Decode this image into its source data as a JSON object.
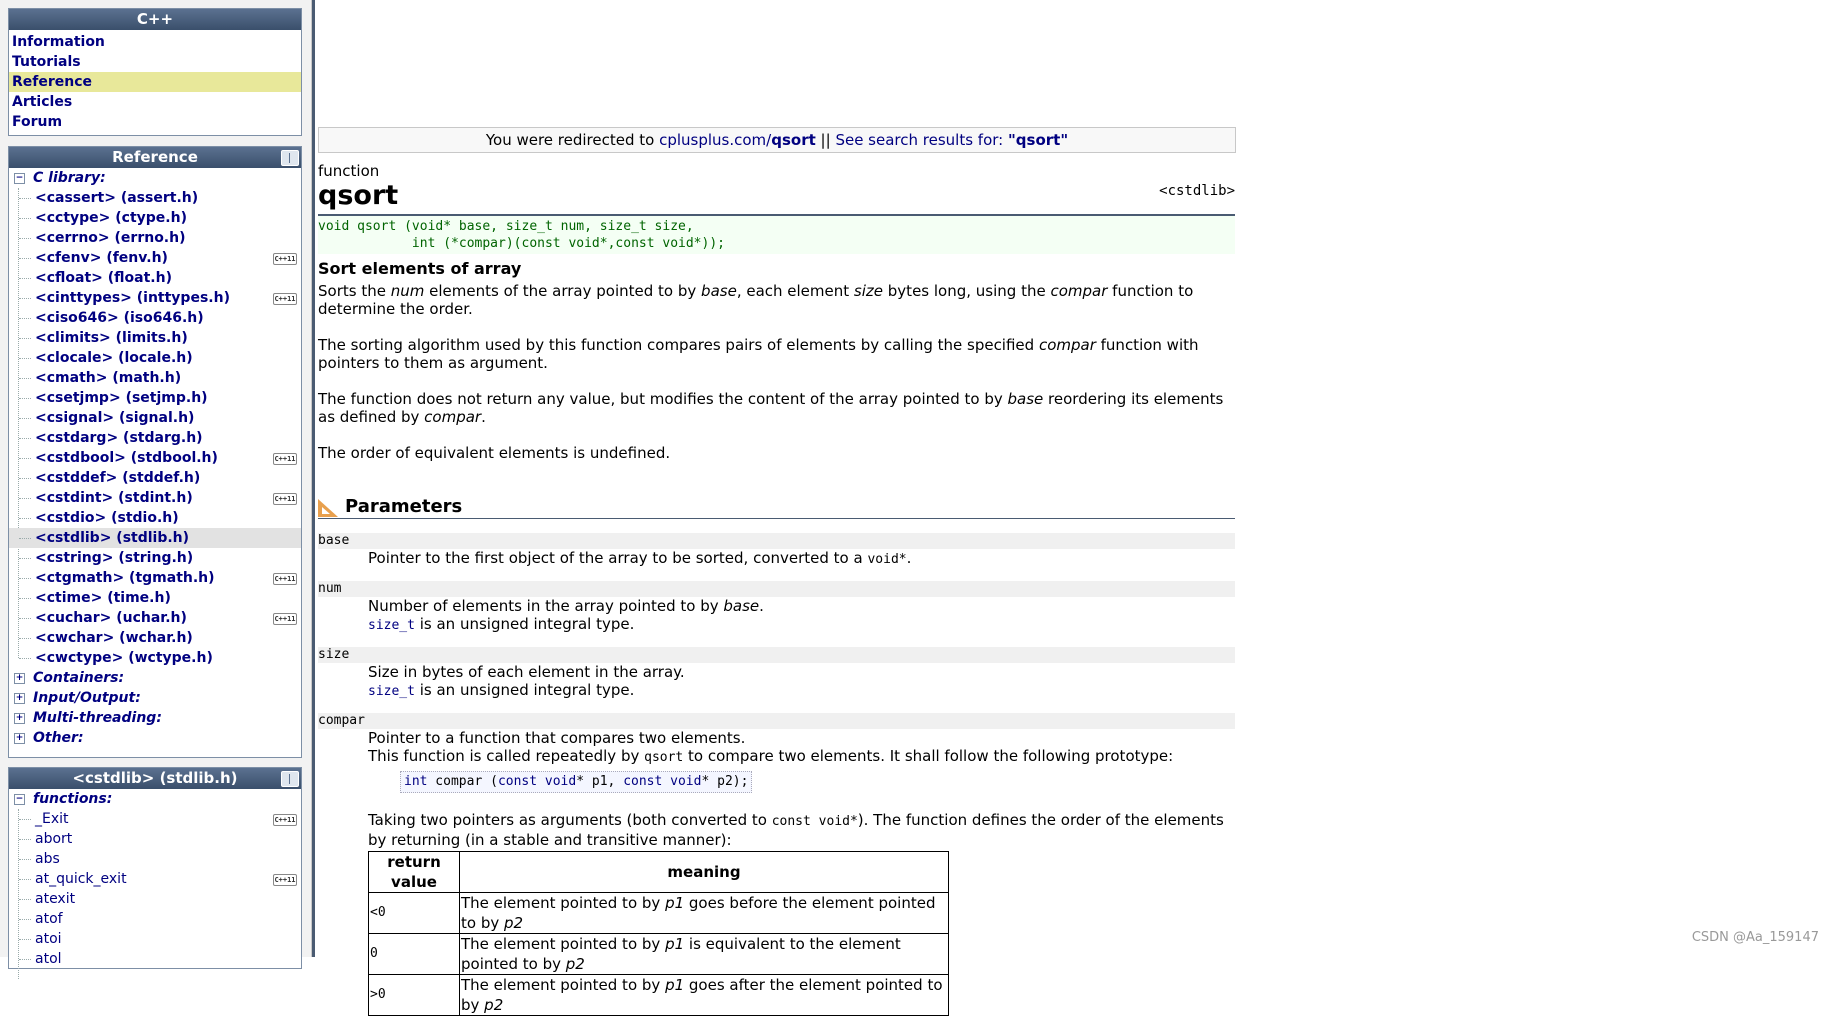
{
  "nav": {
    "title": "C++",
    "items": [
      "Information",
      "Tutorials",
      "Reference",
      "Articles",
      "Forum"
    ],
    "active": "Reference"
  },
  "reference": {
    "title": "Reference",
    "c_library_label": "C library:",
    "headers": [
      {
        "label": "<cassert> (assert.h)",
        "cpp11": false
      },
      {
        "label": "<cctype> (ctype.h)",
        "cpp11": false
      },
      {
        "label": "<cerrno> (errno.h)",
        "cpp11": false
      },
      {
        "label": "<cfenv> (fenv.h)",
        "cpp11": true
      },
      {
        "label": "<cfloat> (float.h)",
        "cpp11": false
      },
      {
        "label": "<cinttypes> (inttypes.h)",
        "cpp11": true
      },
      {
        "label": "<ciso646> (iso646.h)",
        "cpp11": false
      },
      {
        "label": "<climits> (limits.h)",
        "cpp11": false
      },
      {
        "label": "<clocale> (locale.h)",
        "cpp11": false
      },
      {
        "label": "<cmath> (math.h)",
        "cpp11": false
      },
      {
        "label": "<csetjmp> (setjmp.h)",
        "cpp11": false
      },
      {
        "label": "<csignal> (signal.h)",
        "cpp11": false
      },
      {
        "label": "<cstdarg> (stdarg.h)",
        "cpp11": false
      },
      {
        "label": "<cstdbool> (stdbool.h)",
        "cpp11": true
      },
      {
        "label": "<cstddef> (stddef.h)",
        "cpp11": false
      },
      {
        "label": "<cstdint> (stdint.h)",
        "cpp11": true
      },
      {
        "label": "<cstdio> (stdio.h)",
        "cpp11": false
      },
      {
        "label": "<cstdlib> (stdlib.h)",
        "cpp11": false,
        "selected": true
      },
      {
        "label": "<cstring> (string.h)",
        "cpp11": false
      },
      {
        "label": "<ctgmath> (tgmath.h)",
        "cpp11": true
      },
      {
        "label": "<ctime> (time.h)",
        "cpp11": false
      },
      {
        "label": "<cuchar> (uchar.h)",
        "cpp11": true
      },
      {
        "label": "<cwchar> (wchar.h)",
        "cpp11": false
      },
      {
        "label": "<cwctype> (wctype.h)",
        "cpp11": false
      }
    ],
    "categories": [
      "Containers:",
      "Input/Output:",
      "Multi-threading:",
      "Other:"
    ],
    "cpp11_badge": "C++11"
  },
  "cstdlib_box": {
    "title": "<cstdlib> (stdlib.h)",
    "functions_label": "functions:",
    "functions": [
      {
        "label": "_Exit",
        "cpp11": true
      },
      {
        "label": "abort",
        "cpp11": false
      },
      {
        "label": "abs",
        "cpp11": false
      },
      {
        "label": "at_quick_exit",
        "cpp11": true
      },
      {
        "label": "atexit",
        "cpp11": false
      },
      {
        "label": "atof",
        "cpp11": false
      },
      {
        "label": "atoi",
        "cpp11": false
      },
      {
        "label": "atol",
        "cpp11": false
      }
    ]
  },
  "redirect": {
    "prefix": "You were redirected to ",
    "link_prefix": "cplusplus.com/",
    "link_bold": "qsort",
    "sep": " || ",
    "search_text": "See search results for: ",
    "search_term": "\"qsort\""
  },
  "doc": {
    "kind": "function",
    "name": "qsort",
    "header": "<cstdlib>",
    "prototype_line1": "void qsort (void* base, size_t num, size_t size,",
    "prototype_line2": "            int (*compar)(const void*,const void*));",
    "short_desc": "Sort elements of array",
    "p1": {
      "a": "Sorts the ",
      "b": "num",
      "c": " elements of the array pointed to by ",
      "d": "base",
      "e": ", each element ",
      "f": "size",
      "g": " bytes long, using the ",
      "h": "compar",
      "i": " function to determine the order."
    },
    "p2": {
      "a": "The sorting algorithm used by this function compares pairs of elements by calling the specified ",
      "b": "compar",
      "c": " function with pointers to them as argument."
    },
    "p3": {
      "a": "The function does not return any value, but modifies the content of the array pointed to by ",
      "b": "base",
      "c": " reordering its elements as defined by ",
      "d": "compar",
      "e": "."
    },
    "p4": "The order of equivalent elements is undefined.",
    "params_heading": "Parameters",
    "params": {
      "base": {
        "name": "base",
        "a": "Pointer to the first object of the array to be sorted, converted to a ",
        "code": "void*",
        "b": "."
      },
      "num": {
        "name": "num",
        "a": "Number of elements in the array pointed to by ",
        "b": "base",
        "c": ".",
        "type_link": "size_t",
        "type_text": " is an unsigned integral type."
      },
      "size": {
        "name": "size",
        "a": "Size in bytes of each element in the array.",
        "type_link": "size_t",
        "type_text": " is an unsigned integral type."
      },
      "compar": {
        "name": "compar",
        "l1": "Pointer to a function that compares two elements.",
        "l2a": "This function is called repeatedly by ",
        "l2code": "qsort",
        "l2b": " to compare two elements. It shall follow the following prototype:",
        "proto_kw1": "int",
        "proto_mid1": " compar (",
        "proto_kw2": "const void",
        "proto_mid2": "* p1, ",
        "proto_kw3": "const void",
        "proto_mid3": "* p2);",
        "l3a": "Taking two pointers as arguments (both converted to ",
        "l3code": "const void*",
        "l3b": "). The function defines the order of the elements by returning (in a stable and transitive manner):",
        "table_headers": [
          "return value",
          "meaning"
        ],
        "table_rows": [
          {
            "rv": "<0",
            "a": "The element pointed to by ",
            "p1": "p1",
            "b": " goes before the element pointed to by ",
            "p2": "p2"
          },
          {
            "rv": "0",
            "a": "The element pointed to by ",
            "p1": "p1",
            "b": " is equivalent to the element pointed to by ",
            "p2": "p2"
          },
          {
            "rv": ">0",
            "a": "The element pointed to by ",
            "p1": "p1",
            "b": " goes after the element pointed to by ",
            "p2": "p2"
          }
        ]
      }
    }
  },
  "watermark": "CSDN @Aa_159147",
  "colors": {
    "accent": "#000080",
    "header_bg": "#4a5b72",
    "active_nav": "#e8e89a",
    "param_bg": "#f0f0f0"
  }
}
